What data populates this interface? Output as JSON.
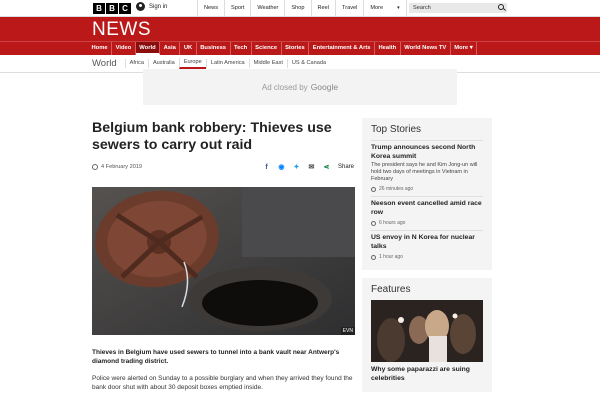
{
  "topbar": {
    "logo_letters": [
      "B",
      "B",
      "C"
    ],
    "signin_label": "Sign in",
    "nav": [
      "News",
      "Sport",
      "Weather",
      "Shop",
      "Reel",
      "Travel",
      "More"
    ],
    "search_placeholder": "Search"
  },
  "masthead": {
    "title": "NEWS"
  },
  "rednav": [
    "Home",
    "Video",
    "World",
    "Asia",
    "UK",
    "Business",
    "Tech",
    "Science",
    "Stories",
    "Entertainment & Arts",
    "Health",
    "World News TV",
    "More"
  ],
  "rednav_active": "World",
  "subnav": {
    "section": "World",
    "items": [
      "Africa",
      "Australia",
      "Europe",
      "Latin America",
      "Middle East",
      "US & Canada"
    ],
    "active": "Europe"
  },
  "ad": {
    "text": "Ad closed by",
    "brand": "Google"
  },
  "article": {
    "headline": "Belgium bank robbery: Thieves use sewers to carry out raid",
    "date": "4 February 2019",
    "share_label": "Share",
    "image_credit": "EVN",
    "lede": "Thieves in Belgium have used sewers to tunnel into a bank vault near Antwerp's diamond trading district.",
    "paragraph": "Police were alerted on Sunday to a possible burglary and when they arrived they found the bank door shut with about 30 deposit boxes emptied inside."
  },
  "sidebar": {
    "top_stories_title": "Top Stories",
    "stories": [
      {
        "title": "Trump announces second North Korea summit",
        "desc": "The president says he and Kim Jong-un will hold two days of meetings in Vietnam in February",
        "time": "26 minutes ago"
      },
      {
        "title": "Neeson event cancelled amid race row",
        "desc": "",
        "time": "6 hours ago"
      },
      {
        "title": "US envoy in N Korea for nuclear talks",
        "desc": "",
        "time": "1 hour ago"
      }
    ],
    "features_title": "Features",
    "feature": {
      "title": "Why some paparazzi are suing celebrities"
    }
  },
  "colors": {
    "brand_red": "#bb1919",
    "panel_bg": "#f4f4f4"
  }
}
